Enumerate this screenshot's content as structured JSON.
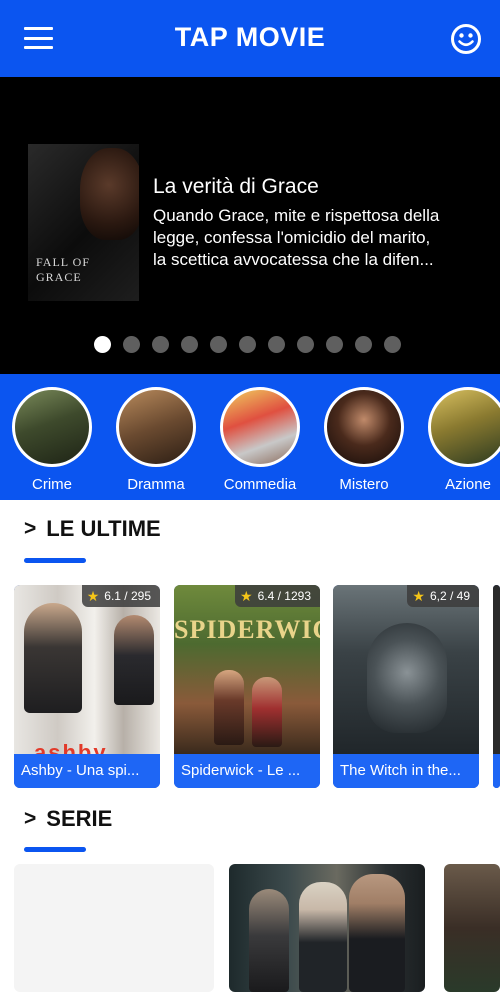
{
  "header": {
    "title": "TAP MOVIE",
    "menu_icon": "hamburger-menu-icon",
    "profile_icon": "smiley-face-icon",
    "brand_color": "#0b55f0"
  },
  "hero": {
    "poster_text": "FALL OF GRACE",
    "title": "La verità di Grace",
    "description_lines": [
      "Quando Grace, mite e rispettosa della",
      "legge, confessa l'omicidio del marito,",
      "la scettica avvocatessa che la difen..."
    ],
    "slides_total": 11,
    "active_slide": 1
  },
  "genres": [
    {
      "label": "Crime"
    },
    {
      "label": "Dramma"
    },
    {
      "label": "Commedia"
    },
    {
      "label": "Mistero"
    },
    {
      "label": "Azione"
    }
  ],
  "latest": {
    "title": "LE ULTIME",
    "cards": [
      {
        "title": "Ashby - Una spi...",
        "rating": "6.1 / 295"
      },
      {
        "title": "Spiderwick - Le ...",
        "rating": "6.4 / 1293"
      },
      {
        "title": "The Witch in the...",
        "rating": "6,2 / 49"
      }
    ]
  },
  "series": {
    "title": "SERIE"
  }
}
